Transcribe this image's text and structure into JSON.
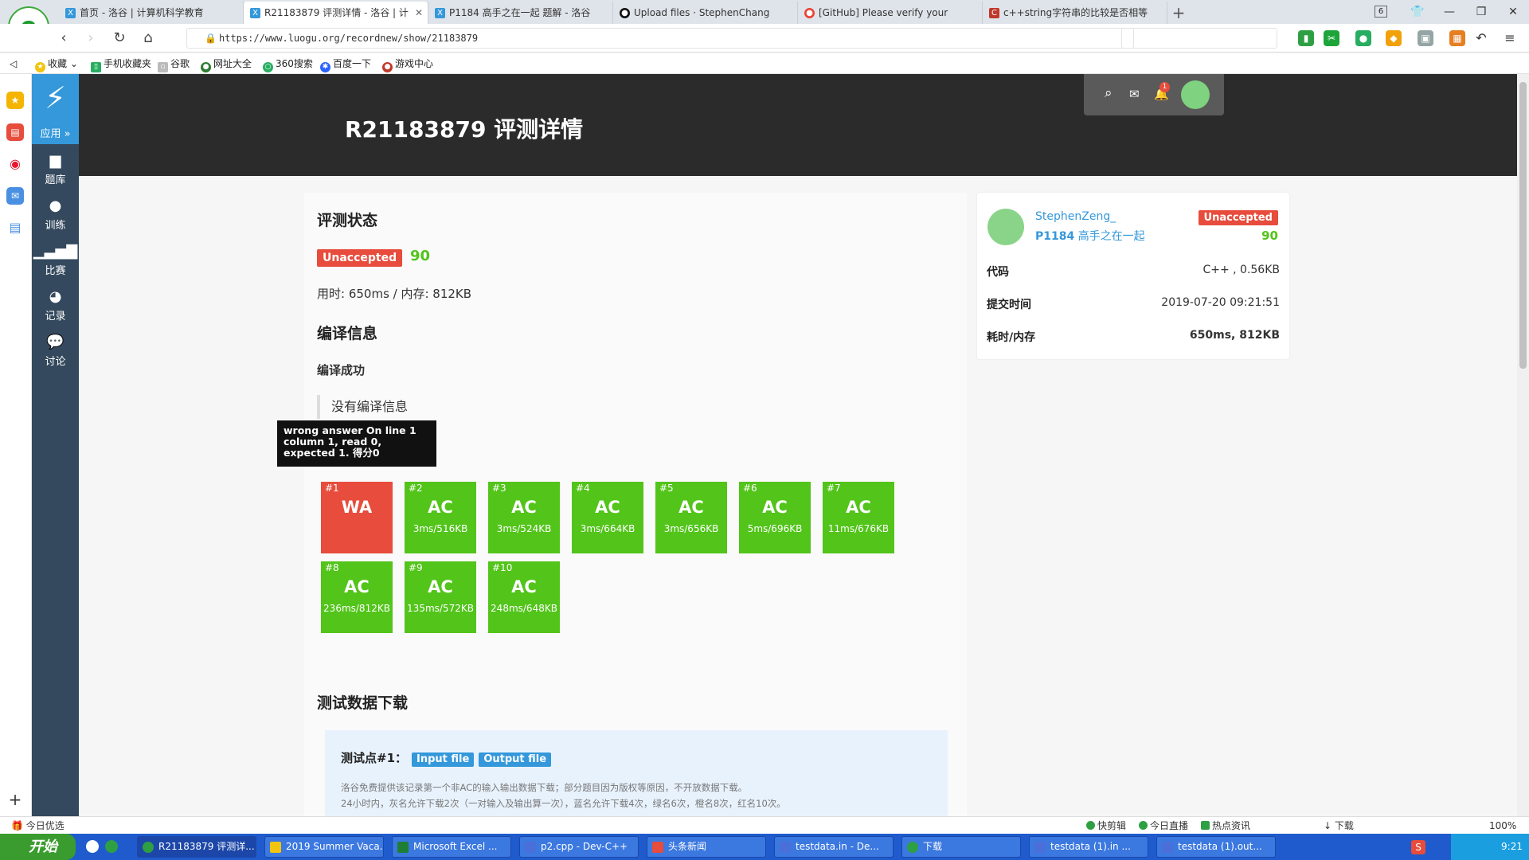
{
  "browser": {
    "tabs": [
      {
        "label": "首页 - 洛谷 | 计算机科学教育",
        "color": "#3498db"
      },
      {
        "label": "R21183879 评测详情 - 洛谷 | 计",
        "color": "#3498db",
        "active": true
      },
      {
        "label": "P1184 高手之在一起 题解 - 洛谷",
        "color": "#3498db"
      },
      {
        "label": "Upload files · StephenChang",
        "color": "#111111"
      },
      {
        "label": "[GitHub] Please verify your",
        "color": "#ea4335"
      },
      {
        "label": "c++string字符串的比较是否相等",
        "color": "#c0392b"
      }
    ],
    "tab_count": "6",
    "url": "https://www.luogu.org/recordnew/show/21183879",
    "bookmarks": [
      "收藏",
      "手机收藏夹",
      "谷歌",
      "网址大全",
      "360搜索",
      "百度一下",
      "游戏中心"
    ],
    "status_left": "今日优选",
    "status_items": [
      "快剪辑",
      "今日直播",
      "热点资讯",
      "下载"
    ],
    "zoom": "100%"
  },
  "sidebar": {
    "apps_label": "应用 »",
    "items": [
      {
        "icon": "book-icon",
        "label": "题库"
      },
      {
        "icon": "lightbulb-icon",
        "label": "训练"
      },
      {
        "icon": "bar-chart-icon",
        "label": "比赛"
      },
      {
        "icon": "pie-chart-icon",
        "label": "记录"
      },
      {
        "icon": "comments-icon",
        "label": "讨论"
      }
    ]
  },
  "header": {
    "title": "R21183879 评测详情",
    "notification_count": "1"
  },
  "main": {
    "status_heading": "评测状态",
    "status_badge": "Unaccepted",
    "score": "90",
    "usage": "用时: 650ms / 内存: 812KB",
    "compile_heading": "编译信息",
    "compile_result": "编译成功",
    "compile_message": "没有编译信息",
    "tooltip": "wrong answer On line 1 column 1, read 0, expected 1. 得分0",
    "testcases": [
      {
        "no": "#1",
        "status": "WA",
        "time": ""
      },
      {
        "no": "#2",
        "status": "AC",
        "time": "3ms/516KB"
      },
      {
        "no": "#3",
        "status": "AC",
        "time": "3ms/524KB"
      },
      {
        "no": "#4",
        "status": "AC",
        "time": "3ms/664KB"
      },
      {
        "no": "#5",
        "status": "AC",
        "time": "3ms/656KB"
      },
      {
        "no": "#6",
        "status": "AC",
        "time": "5ms/696KB"
      },
      {
        "no": "#7",
        "status": "AC",
        "time": "11ms/676KB"
      },
      {
        "no": "#8",
        "status": "AC",
        "time": "236ms/812KB"
      },
      {
        "no": "#9",
        "status": "AC",
        "time": "135ms/572KB"
      },
      {
        "no": "#10",
        "status": "AC",
        "time": "248ms/648KB"
      }
    ],
    "download_heading": "测试数据下载",
    "download": {
      "label": "测试点#1：",
      "input_btn": "Input file",
      "output_btn": "Output file",
      "note1": "洛谷免费提供该记录第一个非AC的输入输出数据下载；部分题目因为版权等原因，不开放数据下载。",
      "note2": "24小时内，灰名允许下载2次（一对输入及输出算一次），蓝名允许下载4次，绿名6次，橙名8次，红名10次。"
    }
  },
  "submission": {
    "user": "StephenZeng_",
    "problem_id": "P1184",
    "problem_name": "高手之在一起",
    "status": "Unaccepted",
    "score": "90",
    "rows": [
      {
        "key": "代码",
        "value": "C++ , 0.56KB"
      },
      {
        "key": "提交时间",
        "value": "2019-07-20 09:21:51"
      },
      {
        "key": "耗时/内存",
        "value": "650ms, 812KB"
      }
    ]
  },
  "taskbar": {
    "start": "开始",
    "items": [
      "R21183879 评测详...",
      "2019 Summer Vaca...",
      "Microsoft Excel ...",
      "p2.cpp - Dev-C++",
      "头条新闻",
      "testdata.in - De...",
      "下载",
      "testdata (1).in ...",
      "testdata (1).out..."
    ],
    "clock": "9:21"
  },
  "colors": {
    "accent": "#3498db",
    "ac": "#52c41a",
    "wa": "#e74c3c",
    "sidebar": "#34495e",
    "header": "#2b2b2b"
  }
}
